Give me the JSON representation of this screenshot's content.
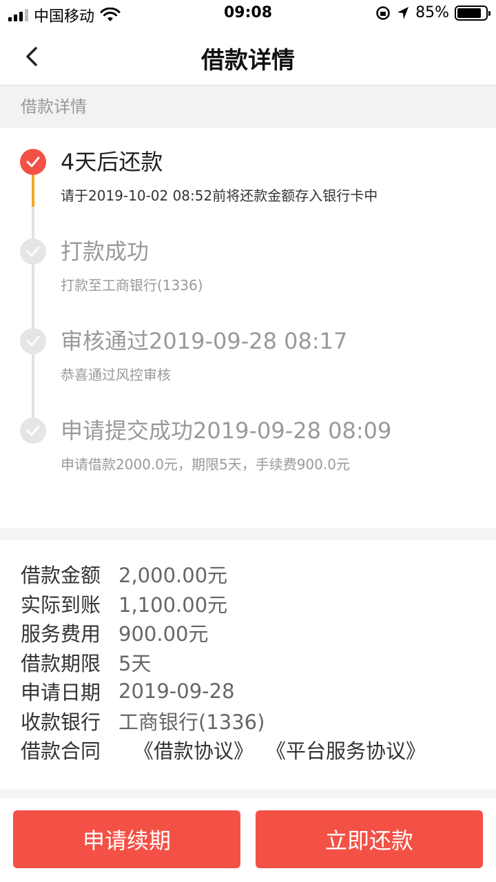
{
  "status_bar": {
    "carrier": "中国移动",
    "time": "09:08",
    "battery": "85%",
    "battery_level": 0.85
  },
  "nav": {
    "title": "借款详情"
  },
  "section": {
    "header": "借款详情"
  },
  "timeline": [
    {
      "title": "4天后还款",
      "subtitle": "请于2019-10-02 08:52前将还款金额存入银行卡中",
      "active": true
    },
    {
      "title": "打款成功",
      "subtitle": "打款至工商银行(1336)",
      "active": false
    },
    {
      "title": "审核通过2019-09-28 08:17",
      "subtitle": "恭喜通过风控审核",
      "active": false
    },
    {
      "title": "申请提交成功2019-09-28 08:09",
      "subtitle": "申请借款2000.0元，期限5天，手续费900.0元",
      "active": false
    }
  ],
  "details": {
    "loan_amount": {
      "label": "借款金额",
      "value": "2,000.00元"
    },
    "received": {
      "label": "实际到账",
      "value": "1,100.00元"
    },
    "service_fee": {
      "label": "服务费用",
      "value": "900.00元"
    },
    "term": {
      "label": "借款期限",
      "value": "5天"
    },
    "apply_date": {
      "label": "申请日期",
      "value": "2019-09-28"
    },
    "bank": {
      "label": "收款银行",
      "value": "工商银行(1336)"
    },
    "contract": {
      "label": "借款合同",
      "link1": "《借款协议》",
      "link2": "《平台服务协议》"
    }
  },
  "actions": {
    "renew": "申请续期",
    "repay": "立即还款"
  },
  "colors": {
    "accent": "#f45146",
    "progress": "#f5a623"
  }
}
